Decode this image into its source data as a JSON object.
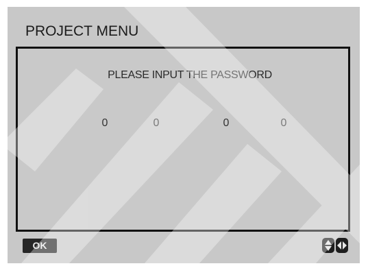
{
  "menu": {
    "title": "PROJECT MENU"
  },
  "password": {
    "prompt": "PLEASE INPUT THE PASSWORD",
    "digits": [
      "0",
      "0",
      "0",
      "0"
    ]
  },
  "footer": {
    "ok_label": "OK",
    "up_down_icon": "up-down-arrows-icon",
    "left_right_icon": "left-right-arrows-icon"
  },
  "colors": {
    "screen_background": "#c8c8c8",
    "panel_border": "#111111",
    "button_background": "#262626"
  }
}
